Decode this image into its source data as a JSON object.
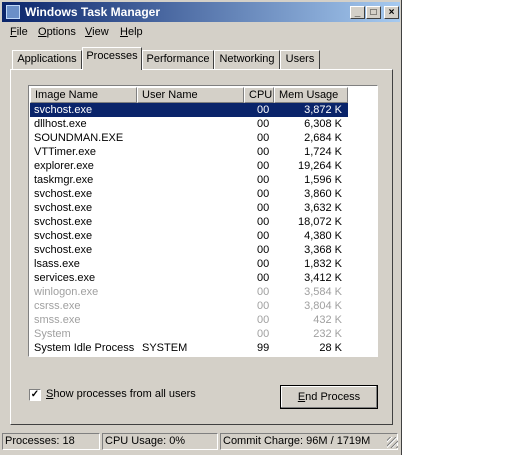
{
  "window": {
    "title": "Windows Task Manager"
  },
  "titlebar_buttons": {
    "minimize": "_",
    "maximize": "□",
    "close": "×"
  },
  "menu": [
    {
      "label": "File",
      "accel": "F",
      "rest": "ile"
    },
    {
      "label": "Options",
      "accel": "O",
      "rest": "ptions"
    },
    {
      "label": "View",
      "accel": "V",
      "rest": "iew"
    },
    {
      "label": "Help",
      "accel": "H",
      "rest": "elp"
    }
  ],
  "tabs": [
    {
      "label": "Applications"
    },
    {
      "label": "Processes"
    },
    {
      "label": "Performance"
    },
    {
      "label": "Networking"
    },
    {
      "label": "Users"
    }
  ],
  "active_tab": "Processes",
  "columns": {
    "image_name": "Image Name",
    "user_name": "User Name",
    "cpu": "CPU",
    "mem_usage": "Mem Usage"
  },
  "processes": [
    {
      "name": "svchost.exe",
      "user": "",
      "cpu": "00",
      "mem": "3,872 K",
      "selected": true,
      "dim": false
    },
    {
      "name": "dllhost.exe",
      "user": "",
      "cpu": "00",
      "mem": "6,308 K",
      "selected": false,
      "dim": false
    },
    {
      "name": "SOUNDMAN.EXE",
      "user": "",
      "cpu": "00",
      "mem": "2,684 K",
      "selected": false,
      "dim": false
    },
    {
      "name": "VTTimer.exe",
      "user": "",
      "cpu": "00",
      "mem": "1,724 K",
      "selected": false,
      "dim": false
    },
    {
      "name": "explorer.exe",
      "user": "",
      "cpu": "00",
      "mem": "19,264 K",
      "selected": false,
      "dim": false
    },
    {
      "name": "taskmgr.exe",
      "user": "",
      "cpu": "00",
      "mem": "1,596 K",
      "selected": false,
      "dim": false
    },
    {
      "name": "svchost.exe",
      "user": "",
      "cpu": "00",
      "mem": "3,860 K",
      "selected": false,
      "dim": false
    },
    {
      "name": "svchost.exe",
      "user": "",
      "cpu": "00",
      "mem": "3,632 K",
      "selected": false,
      "dim": false
    },
    {
      "name": "svchost.exe",
      "user": "",
      "cpu": "00",
      "mem": "18,072 K",
      "selected": false,
      "dim": false
    },
    {
      "name": "svchost.exe",
      "user": "",
      "cpu": "00",
      "mem": "4,380 K",
      "selected": false,
      "dim": false
    },
    {
      "name": "svchost.exe",
      "user": "",
      "cpu": "00",
      "mem": "3,368 K",
      "selected": false,
      "dim": false
    },
    {
      "name": "lsass.exe",
      "user": "",
      "cpu": "00",
      "mem": "1,832 K",
      "selected": false,
      "dim": false
    },
    {
      "name": "services.exe",
      "user": "",
      "cpu": "00",
      "mem": "3,412 K",
      "selected": false,
      "dim": false
    },
    {
      "name": "winlogon.exe",
      "user": "",
      "cpu": "00",
      "mem": "3,584 K",
      "selected": false,
      "dim": true
    },
    {
      "name": "csrss.exe",
      "user": "",
      "cpu": "00",
      "mem": "3,804 K",
      "selected": false,
      "dim": true
    },
    {
      "name": "smss.exe",
      "user": "",
      "cpu": "00",
      "mem": "432 K",
      "selected": false,
      "dim": true
    },
    {
      "name": "System",
      "user": "",
      "cpu": "00",
      "mem": "232 K",
      "selected": false,
      "dim": true
    },
    {
      "name": "System Idle Process",
      "user": "SYSTEM",
      "cpu": "99",
      "mem": "28 K",
      "selected": false,
      "dim": false
    }
  ],
  "show_all_users": {
    "label": "Show processes from all users",
    "accel": "S",
    "rest": "how processes from all users",
    "checked": true,
    "check_glyph": "✓"
  },
  "end_process": {
    "label": "End Process",
    "accel": "E",
    "rest": "nd Process"
  },
  "status": {
    "processes": "Processes: 18",
    "cpu_usage": "CPU Usage: 0%",
    "commit_charge": "Commit Charge: 96M / 1719M"
  },
  "colors": {
    "title_start": "#0a246a",
    "title_end": "#a6caf0",
    "face": "#d4d0c8",
    "selection": "#0a246a"
  }
}
